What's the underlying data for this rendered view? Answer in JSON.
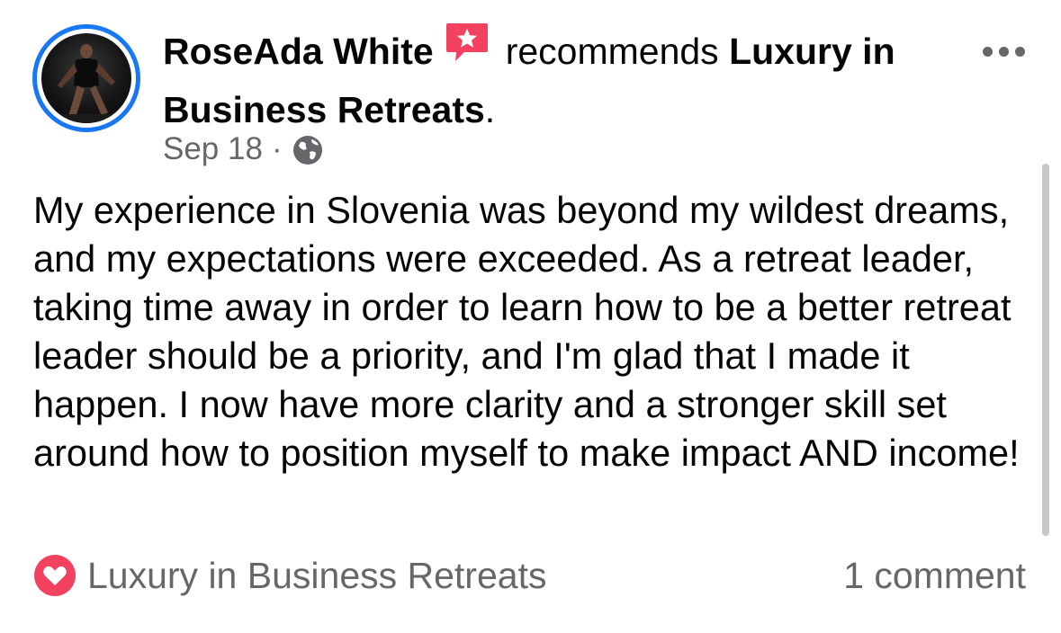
{
  "post": {
    "author": "RoseAda White",
    "action": "recommends",
    "page_name": "Luxury in Business Retreats",
    "date": "Sep 18",
    "separator": "·",
    "audience_icon": "globe-icon",
    "badge_icon": "recommendation-star-badge-icon",
    "body": "My experience in Slovenia was beyond my wildest dreams, and my expectations were exceeded. As a retreat leader, taking time away in order to learn how to be a better retreat leader should be a priority, and I'm glad that I made it happen. I now have more clarity and a stronger skill set around how to position myself to make impact AND income!"
  },
  "footer": {
    "reaction_icon": "heart-reaction-icon",
    "reaction_label": "Luxury in Business Retreats",
    "comment_count": "1 comment"
  },
  "colors": {
    "avatar_ring": "#1877f2",
    "badge": "#f3425f",
    "heart": "#f3425f",
    "secondary_text": "#65676b",
    "primary_text": "#050505"
  }
}
